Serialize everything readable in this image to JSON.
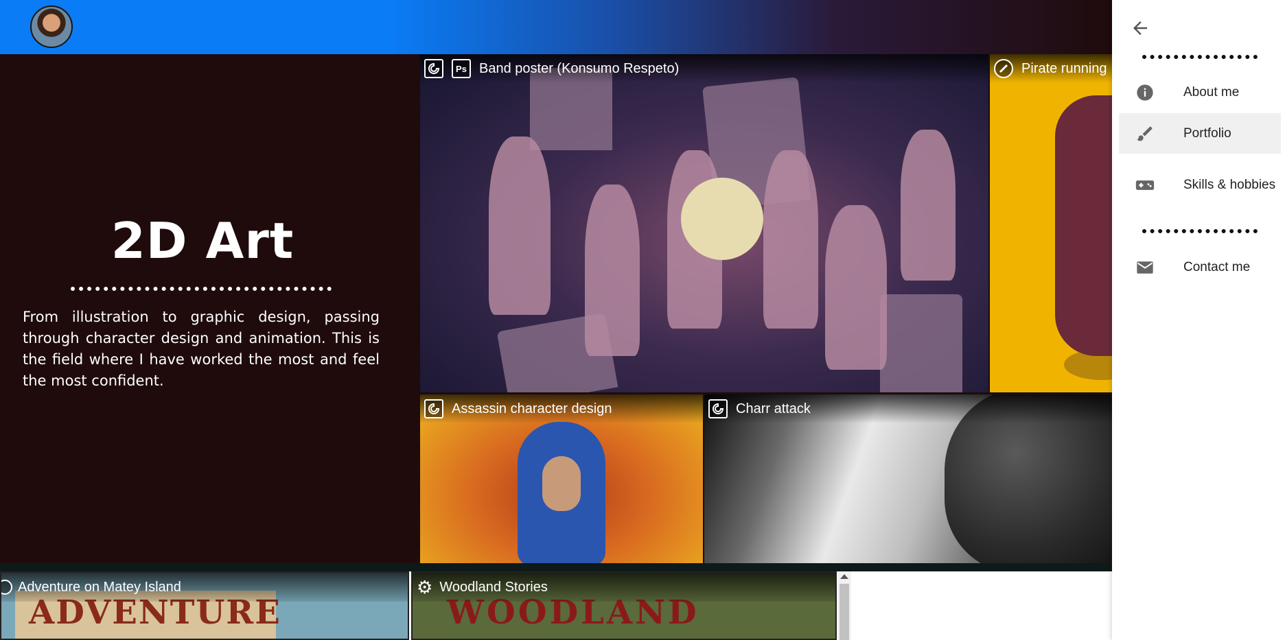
{
  "header": {
    "avatar_alt": ""
  },
  "intro": {
    "title": "2D Art",
    "text": "From illustration to graphic design, passing through character design and animation. This is the field where I have worked the most and feel the most confident."
  },
  "gallery": {
    "band": {
      "title": "Band poster (Konsumo Respeto)",
      "badge_ps": "Ps"
    },
    "pirate": {
      "title": "Pirate running"
    },
    "assassin": {
      "title": "Assassin character design"
    },
    "charr": {
      "title": "Charr attack"
    },
    "adventure": {
      "title": "Adventure on Matey Island",
      "art_text": "ADVENTURE"
    },
    "woodland": {
      "title": "Woodland Stories",
      "art_text": "WOODLAND"
    }
  },
  "drawer": {
    "items": [
      {
        "label": "About me",
        "icon": "info-icon"
      },
      {
        "label": "Portfolio",
        "icon": "brush-icon"
      },
      {
        "label": "Skills & hobbies",
        "icon": "gamepad-icon"
      },
      {
        "label": "Contact me",
        "icon": "mail-icon"
      }
    ],
    "active": "Portfolio"
  }
}
